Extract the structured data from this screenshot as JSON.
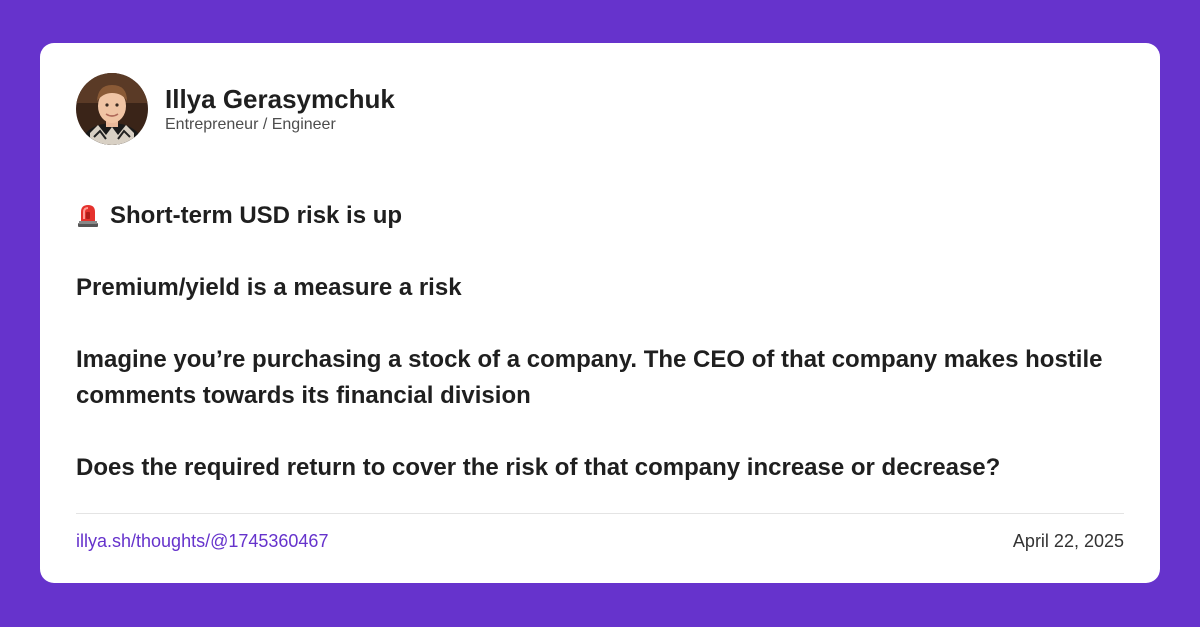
{
  "author": {
    "name": "Illya Gerasymchuk",
    "role": "Entrepreneur / Engineer"
  },
  "post": {
    "headline_icon": "siren-icon",
    "headline": "Short-term USD risk is up",
    "paragraphs": [
      "Premium/yield is a measure a risk",
      "Imagine you’re purchasing a stock of a company. The CEO of that company makes hostile comments towards its financial division",
      "Does the required return to cover the risk of that company increase or decrease?"
    ]
  },
  "footer": {
    "link": "illya.sh/thoughts/@1745360467",
    "date": "April 22, 2025"
  },
  "colors": {
    "background": "#6633cc",
    "card": "#ffffff",
    "link": "#6633cc",
    "text": "#1f1f1f"
  }
}
